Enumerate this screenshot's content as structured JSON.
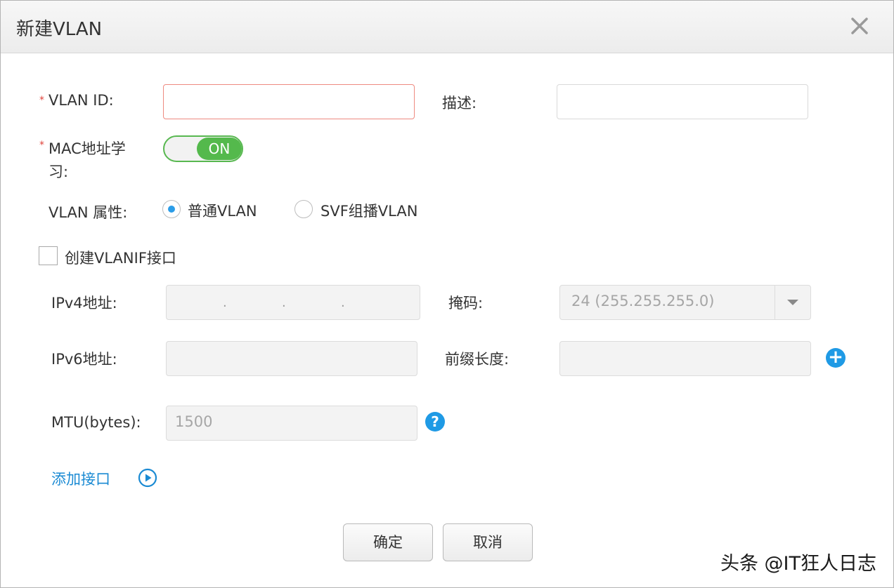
{
  "dialog": {
    "title": "新建VLAN",
    "close_icon": "close-icon"
  },
  "form": {
    "vlan_id": {
      "required_mark": "*",
      "label": "VLAN ID:",
      "value": "",
      "state": "error"
    },
    "description": {
      "label": "描述:",
      "value": ""
    },
    "mac_learning": {
      "required_mark": "*",
      "label_line1": "MAC地址学",
      "label_line2": "习:",
      "toggle_label": "ON",
      "enabled": true
    },
    "vlan_attr": {
      "label": "VLAN 属性:",
      "options": [
        {
          "label": "普通VLAN",
          "checked": true
        },
        {
          "label": "SVF组播VLAN",
          "checked": false
        }
      ]
    },
    "create_vlanif": {
      "label": "创建VLANIF接口",
      "checked": false
    },
    "ipv4": {
      "label": "IPv4地址:",
      "separators": [
        ".",
        ".",
        "."
      ],
      "disabled": true
    },
    "mask": {
      "label": "掩码:",
      "value": "24 (255.255.255.0)",
      "icon": "chevron-down-icon",
      "disabled": true
    },
    "ipv6": {
      "label": "IPv6地址:",
      "value": "",
      "disabled": true
    },
    "prefix_length": {
      "label": "前缀长度:",
      "value": "",
      "add_icon": "plus-circle-icon",
      "add_symbol": "+",
      "disabled": true
    },
    "mtu": {
      "label": "MTU(bytes):",
      "value": "1500",
      "help_icon": "question-circle-icon",
      "help_symbol": "?",
      "disabled": true
    },
    "add_interface": {
      "label": "添加接口",
      "icon": "play-circle-icon"
    }
  },
  "footer": {
    "confirm_label": "确定",
    "cancel_label": "取消"
  },
  "watermark": "头条 @IT狂人日志",
  "colors": {
    "accent_blue": "#1f9ae5",
    "toggle_green": "#54b94c",
    "error_border": "#ee8a80",
    "required_red": "#e0443c"
  }
}
